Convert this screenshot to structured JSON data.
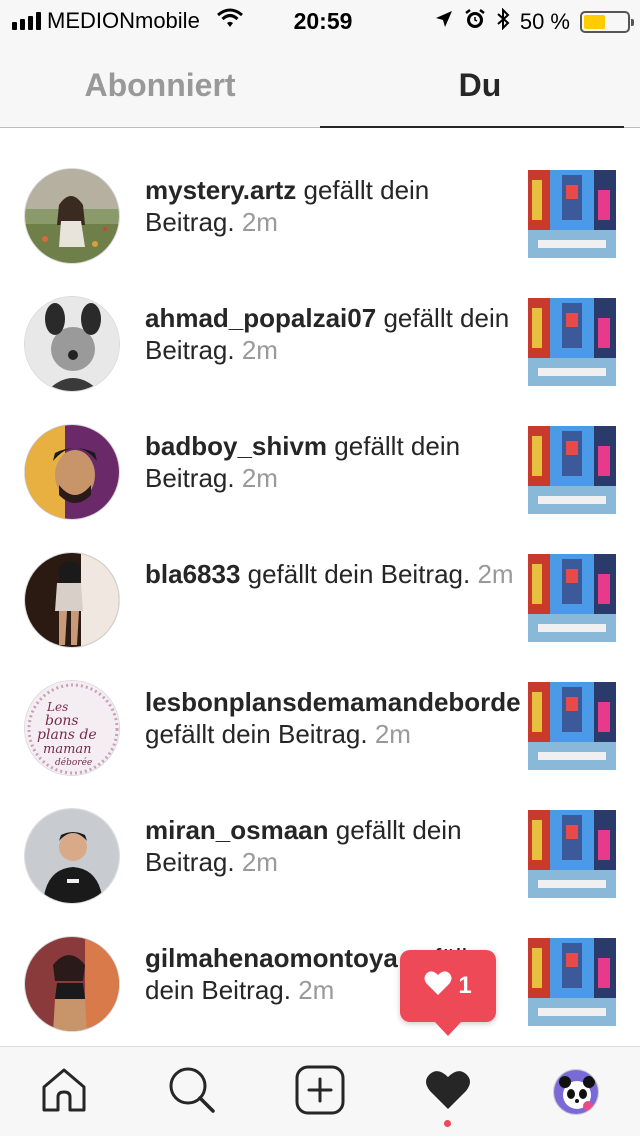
{
  "status_bar": {
    "carrier": "MEDIONmobile",
    "time": "20:59",
    "battery_percent_label": "50 %",
    "battery_level": 0.5,
    "icons": [
      "signal-icon",
      "wifi-icon",
      "location-arrow-icon",
      "alarm-icon",
      "bluetooth-icon",
      "battery-icon"
    ]
  },
  "tabs": [
    {
      "label": "Abonniert",
      "active": false
    },
    {
      "label": "Du",
      "active": true
    }
  ],
  "activity": [
    {
      "username": "mystery.artz",
      "action": "gefällt dein Beitrag.",
      "time": "2m"
    },
    {
      "username": "ahmad_popalzai07",
      "action": "gefällt dein Beitrag.",
      "time": "2m"
    },
    {
      "username": "badboy_shivm",
      "action": "gefällt dein Beitrag.",
      "time": "2m"
    },
    {
      "username": "bla6833",
      "action": "gefällt dein Beitrag.",
      "time": "2m"
    },
    {
      "username": "lesbonplansdemamandeborde",
      "action": "gefällt dein Beitrag.",
      "time": "2m",
      "avatar_logo_text": "Les bons plans de maman déborée"
    },
    {
      "username": "miran_osmaan",
      "action": "gefällt dein Beitrag.",
      "time": "2m"
    },
    {
      "username": "gilmahenaomontoya",
      "action": "gefällt dein Beitrag.",
      "time": "2m"
    }
  ],
  "notification_bubble": {
    "icon": "heart-icon",
    "count": "1"
  },
  "bottom_nav": [
    "home-icon",
    "search-icon",
    "add-post-icon",
    "activity-heart-icon",
    "profile-avatar"
  ],
  "colors": {
    "accent_red": "#ed4956",
    "text": "#262626",
    "muted": "#999999",
    "battery": "#ffcc00"
  }
}
